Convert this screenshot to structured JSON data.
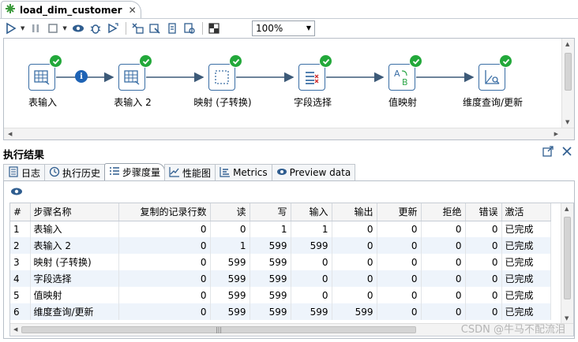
{
  "file_tab": {
    "title": "load_dim_customer",
    "close": "✕"
  },
  "toolbar": {
    "zoom": "100%"
  },
  "steps": [
    {
      "label": "表输入",
      "icon": "table-input-icon"
    },
    {
      "label": "表输入 2",
      "icon": "table-input-icon"
    },
    {
      "label": "映射 (子转换)",
      "icon": "mapping-icon"
    },
    {
      "label": "字段选择",
      "icon": "select-values-icon"
    },
    {
      "label": "值映射",
      "icon": "value-mapper-icon"
    },
    {
      "label": "维度查询/更新",
      "icon": "dimension-lookup-icon"
    }
  ],
  "results": {
    "title": "执行结果",
    "tabs": [
      {
        "label": "日志",
        "icon": "log-icon"
      },
      {
        "label": "执行历史",
        "icon": "history-icon"
      },
      {
        "label": "步骤度量",
        "icon": "step-metrics-icon"
      },
      {
        "label": "性能图",
        "icon": "performance-chart-icon"
      },
      {
        "label": "Metrics",
        "icon": "metrics-icon"
      },
      {
        "label": "Preview data",
        "icon": "preview-eye-icon"
      }
    ]
  },
  "table": {
    "columns": [
      "#",
      "步骤名称",
      "复制的记录行数",
      "读",
      "写",
      "输入",
      "输出",
      "更新",
      "拒绝",
      "错误",
      "激活"
    ],
    "rows": [
      [
        "1",
        "表输入",
        "0",
        "0",
        "1",
        "1",
        "0",
        "0",
        "0",
        "0",
        "已完成"
      ],
      [
        "2",
        "表输入 2",
        "0",
        "1",
        "599",
        "599",
        "0",
        "0",
        "0",
        "0",
        "已完成"
      ],
      [
        "3",
        "映射 (子转换)",
        "0",
        "599",
        "599",
        "0",
        "0",
        "0",
        "0",
        "0",
        "已完成"
      ],
      [
        "4",
        "字段选择",
        "0",
        "599",
        "599",
        "0",
        "0",
        "0",
        "0",
        "0",
        "已完成"
      ],
      [
        "5",
        "值映射",
        "0",
        "599",
        "599",
        "0",
        "0",
        "0",
        "0",
        "0",
        "已完成"
      ],
      [
        "6",
        "维度查询/更新",
        "0",
        "599",
        "599",
        "599",
        "599",
        "0",
        "0",
        "0",
        "已完成"
      ]
    ]
  },
  "watermark": "CSDN @牛马不配流泪"
}
